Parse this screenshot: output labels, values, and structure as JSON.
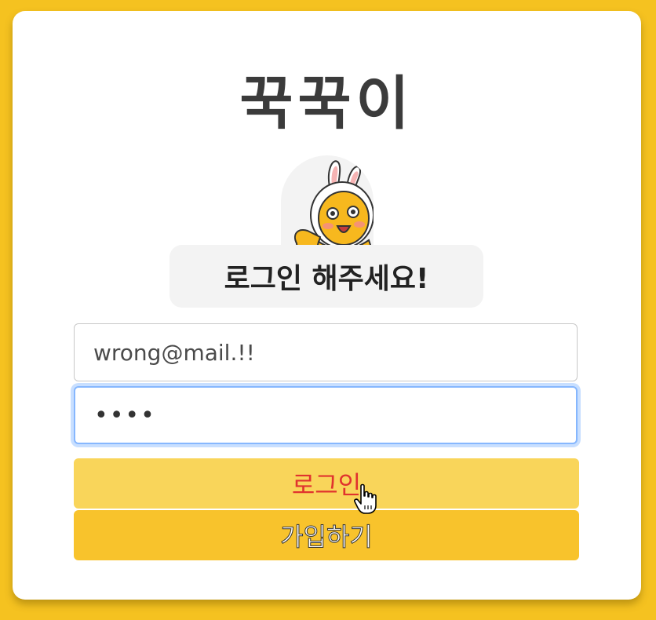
{
  "app": {
    "title": "꾹꾹이"
  },
  "mascot": {
    "icon": "bunny-mascot-icon"
  },
  "login_prompt": "로그인 해주세요!",
  "form": {
    "email_value": "wrong@mail.!!",
    "password_value": "••••"
  },
  "buttons": {
    "login_label": "로그인",
    "signup_label": "가입하기"
  },
  "colors": {
    "background": "#f5c220",
    "login_button_bg": "#f9d55a",
    "login_button_text": "#e0332e",
    "signup_button_bg": "#f8c32c",
    "focus_ring": "#86b7fe"
  },
  "cursor": {
    "icon": "hand-pointer-icon"
  }
}
